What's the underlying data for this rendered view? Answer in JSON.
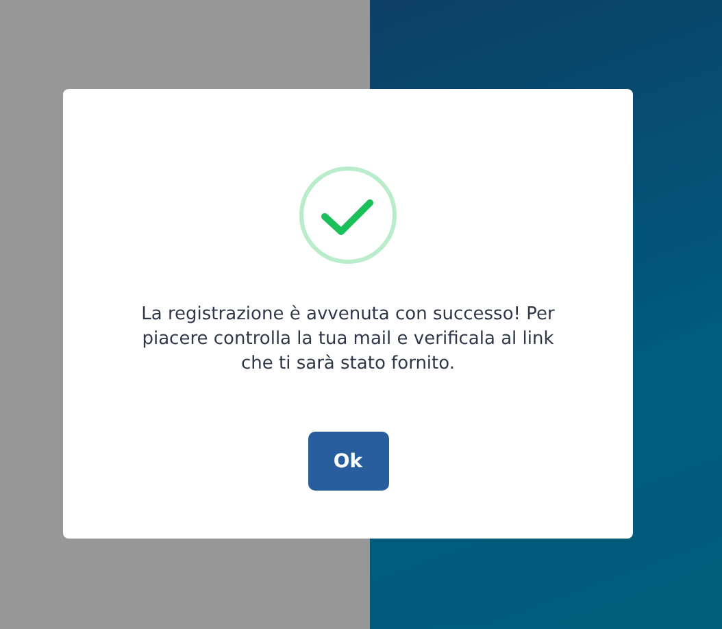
{
  "dialog": {
    "kind": "success",
    "message": "La registrazione è avvenuta con successo! Per piacere controlla la tua mail e verificala al link che ti sarà stato fornito.",
    "button": "Ok"
  }
}
